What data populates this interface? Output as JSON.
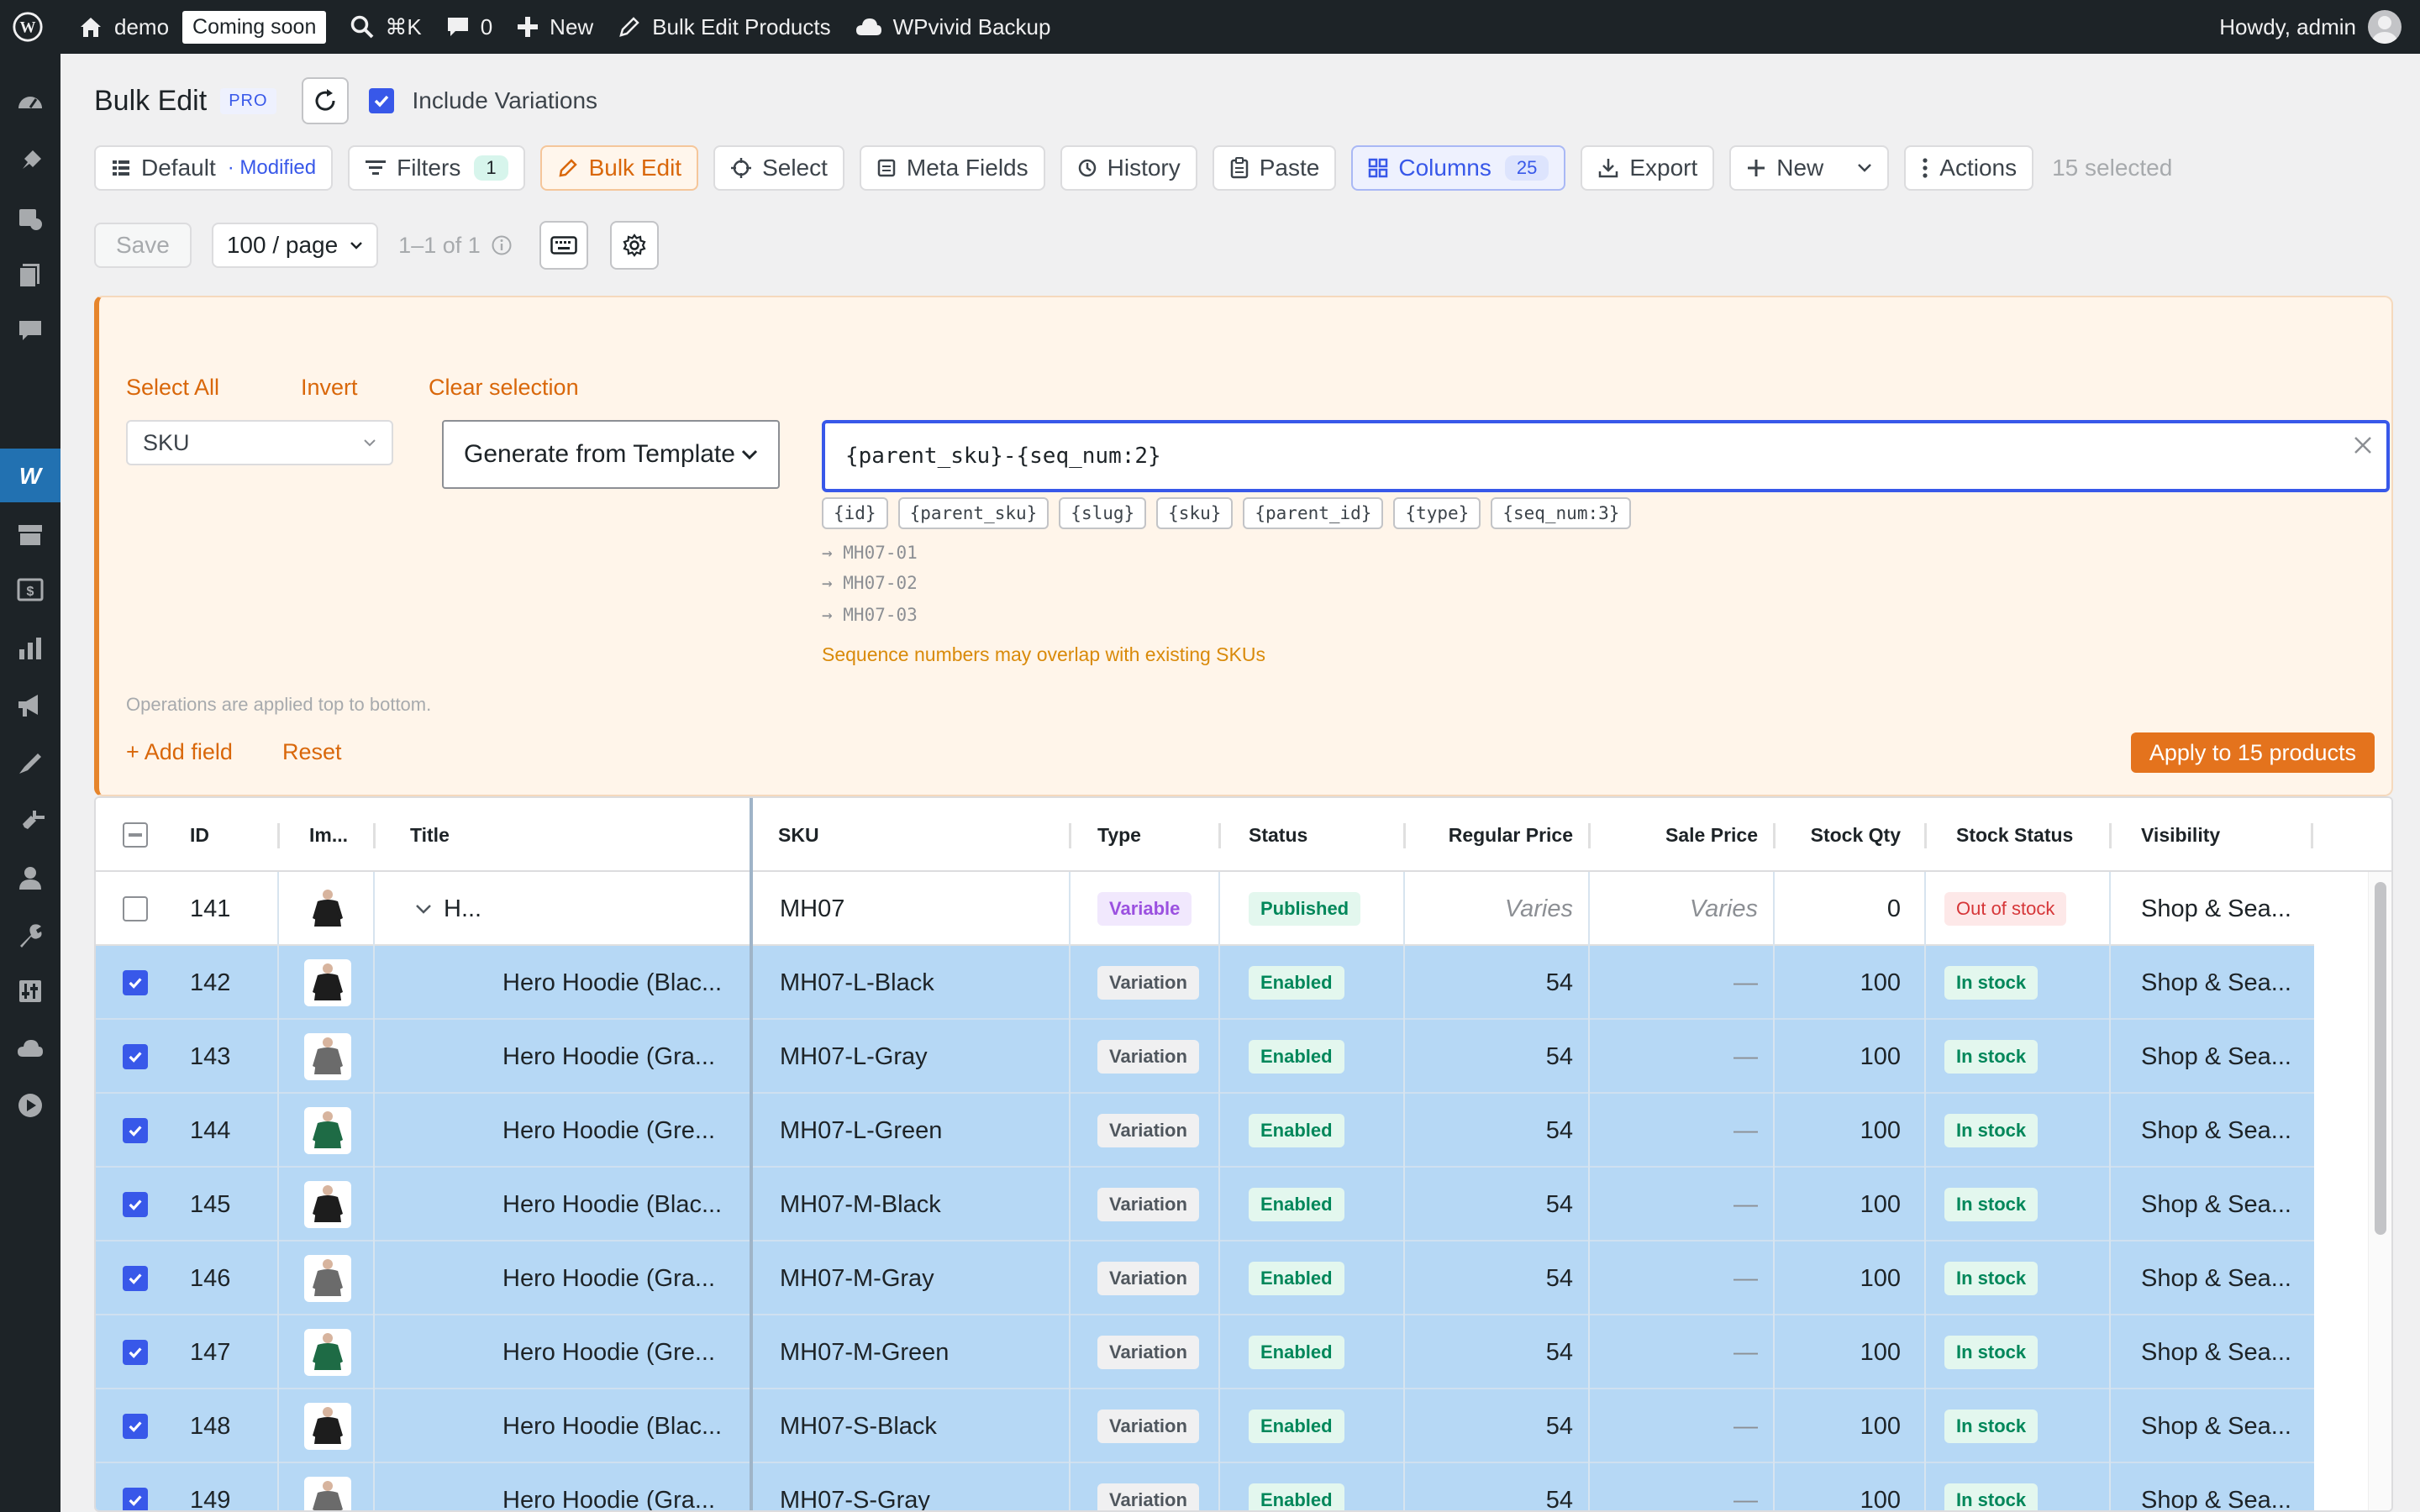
{
  "admin_bar": {
    "site_name": "demo",
    "coming_soon": "Coming soon",
    "shortcut": "⌘K",
    "comments_count": "0",
    "new_label": "New",
    "bulk_edit_products": "Bulk Edit Products",
    "backup": "WPvivid Backup",
    "howdy": "Howdy, admin"
  },
  "header": {
    "title": "Bulk Edit",
    "badge": "PRO",
    "include_variations_label": "Include Variations"
  },
  "toolbar": {
    "default_label": "Default",
    "modified_label": "· Modified",
    "filters_label": "Filters",
    "filters_count": "1",
    "bulk_edit_label": "Bulk Edit",
    "select_label": "Select",
    "meta_fields_label": "Meta Fields",
    "history_label": "History",
    "paste_label": "Paste",
    "columns_label": "Columns",
    "columns_count": "25",
    "export_label": "Export",
    "new_label": "New",
    "actions_label": "Actions",
    "selected_text": "15 selected"
  },
  "pagination": {
    "save_label": "Save",
    "per_page": "100 / page",
    "range": "1–1 of 1"
  },
  "bulk_panel": {
    "select_all": "Select All",
    "invert": "Invert",
    "clear_selection": "Clear selection",
    "field": "SKU",
    "mode": "Generate from Template",
    "template": "{parent_sku}-{seq_num:2}",
    "tokens": [
      "{id}",
      "{parent_sku}",
      "{slug}",
      "{sku}",
      "{parent_id}",
      "{type}",
      "{seq_num:3}"
    ],
    "previews": [
      "→ MH07-01",
      "→ MH07-02",
      "→ MH07-03"
    ],
    "warning": "Sequence numbers may overlap with existing SKUs",
    "ops_note": "Operations are applied top to bottom.",
    "add_field": "+ Add field",
    "reset": "Reset",
    "apply": "Apply to 15 products"
  },
  "table": {
    "columns": [
      "ID",
      "Im...",
      "Title",
      "SKU",
      "Type",
      "Status",
      "Regular Price",
      "Sale Price",
      "Stock Qty",
      "Stock Status",
      "Visibility"
    ],
    "rows": [
      {
        "id": "141",
        "title": "H...",
        "sku": "MH07",
        "type": "Variable",
        "status": "Published",
        "regular": "Varies",
        "sale": "Varies",
        "qty": "0",
        "stock": "Out of stock",
        "visibility": "Shop & Sea...",
        "selected": false,
        "parent": true,
        "color": "black"
      },
      {
        "id": "142",
        "title": "Hero Hoodie (Blac...",
        "sku": "MH07-L-Black",
        "type": "Variation",
        "status": "Enabled",
        "regular": "54",
        "sale": "—",
        "qty": "100",
        "stock": "In stock",
        "visibility": "Shop & Sea...",
        "selected": true,
        "parent": false,
        "color": "black"
      },
      {
        "id": "143",
        "title": "Hero Hoodie (Gra...",
        "sku": "MH07-L-Gray",
        "type": "Variation",
        "status": "Enabled",
        "regular": "54",
        "sale": "—",
        "qty": "100",
        "stock": "In stock",
        "visibility": "Shop & Sea...",
        "selected": true,
        "parent": false,
        "color": "gray"
      },
      {
        "id": "144",
        "title": "Hero Hoodie (Gre...",
        "sku": "MH07-L-Green",
        "type": "Variation",
        "status": "Enabled",
        "regular": "54",
        "sale": "—",
        "qty": "100",
        "stock": "In stock",
        "visibility": "Shop & Sea...",
        "selected": true,
        "parent": false,
        "color": "green"
      },
      {
        "id": "145",
        "title": "Hero Hoodie (Blac...",
        "sku": "MH07-M-Black",
        "type": "Variation",
        "status": "Enabled",
        "regular": "54",
        "sale": "—",
        "qty": "100",
        "stock": "In stock",
        "visibility": "Shop & Sea...",
        "selected": true,
        "parent": false,
        "color": "black"
      },
      {
        "id": "146",
        "title": "Hero Hoodie (Gra...",
        "sku": "MH07-M-Gray",
        "type": "Variation",
        "status": "Enabled",
        "regular": "54",
        "sale": "—",
        "qty": "100",
        "stock": "In stock",
        "visibility": "Shop & Sea...",
        "selected": true,
        "parent": false,
        "color": "gray"
      },
      {
        "id": "147",
        "title": "Hero Hoodie (Gre...",
        "sku": "MH07-M-Green",
        "type": "Variation",
        "status": "Enabled",
        "regular": "54",
        "sale": "—",
        "qty": "100",
        "stock": "In stock",
        "visibility": "Shop & Sea...",
        "selected": true,
        "parent": false,
        "color": "green"
      },
      {
        "id": "148",
        "title": "Hero Hoodie (Blac...",
        "sku": "MH07-S-Black",
        "type": "Variation",
        "status": "Enabled",
        "regular": "54",
        "sale": "—",
        "qty": "100",
        "stock": "In stock",
        "visibility": "Shop & Sea...",
        "selected": true,
        "parent": false,
        "color": "black"
      },
      {
        "id": "149",
        "title": "Hero Hoodie (Gra...",
        "sku": "MH07-S-Gray",
        "type": "Variation",
        "status": "Enabled",
        "regular": "54",
        "sale": "—",
        "qty": "100",
        "stock": "In stock",
        "visibility": "Shop & Sea...",
        "selected": true,
        "parent": false,
        "color": "gray"
      }
    ]
  },
  "colors": {
    "accent": "#3858e9",
    "bulk_accent": "#e4731d",
    "selected_row": "#b6d8f5",
    "admin_bar": "#1d2327"
  },
  "icons": [
    "wordpress-icon",
    "home-icon",
    "search-icon",
    "comment-icon",
    "plus-icon",
    "pencil-icon",
    "cloud-icon",
    "refresh-icon",
    "keyboard-icon",
    "gear-icon",
    "close-icon",
    "chevron-down-icon",
    "info-icon"
  ]
}
